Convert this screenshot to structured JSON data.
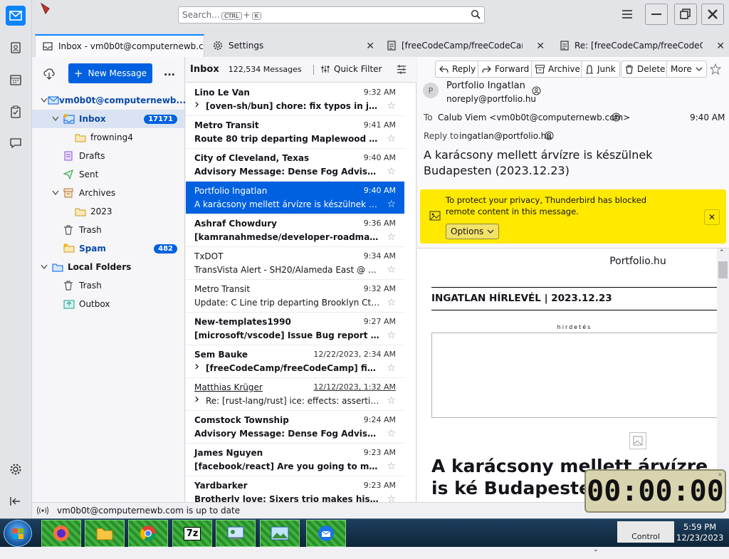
{
  "search": {
    "placeholder": "Search...",
    "key1": "CTRL",
    "plus": "+",
    "key2": "K"
  },
  "tabs": [
    {
      "label": "Inbox - vm0b0t@computernewb.com"
    },
    {
      "label": "Settings"
    },
    {
      "label": "[freeCodeCamp/freeCodeCamp] f"
    },
    {
      "label": "Re: [freeCodeCamp/freeCodeCam"
    }
  ],
  "folders": {
    "new_message": "New Message",
    "more": "...",
    "account": "vm0b0t@computernewb...",
    "inbox": "Inbox",
    "inbox_count": "17171",
    "frowning": "frowning4",
    "drafts": "Drafts",
    "sent": "Sent",
    "archives": "Archives",
    "archives_year": "2023",
    "trash": "Trash",
    "spam": "Spam",
    "spam_count": "482",
    "local_folders": "Local Folders",
    "local_trash": "Trash",
    "outbox": "Outbox"
  },
  "list": {
    "title": "Inbox",
    "count": "122,534 Messages",
    "quick_filter": "Quick Filter",
    "messages": [
      {
        "from": "Lino Le Van",
        "date": "9:32 AM",
        "subject": "[oven-sh/bun] chore: fix typos in js_p...",
        "thread": true
      },
      {
        "from": "Metro Transit",
        "date": "9:41 AM",
        "subject": "Route 80 trip departing Maplewood Mal..."
      },
      {
        "from": "City of Cleveland, Texas",
        "date": "9:40 AM",
        "subject": "Advisory Message: Dense Fog Advisory..."
      },
      {
        "from": "Portfolio Ingatlan",
        "date": "9:40 AM",
        "subject": "A karácsony mellett árvízre is készülnek Bu..."
      },
      {
        "from": "Ashraf Chowdury",
        "date": "9:36 AM",
        "subject": "[kamranahmedse/developer-roadmap] ..."
      },
      {
        "from": "TxDOT",
        "date": "9:34 AM",
        "subject": "TransVista Alert - SH20/Alameda East @ D..."
      },
      {
        "from": "Metro Transit",
        "date": "9:32 AM",
        "subject": "Update: C Line trip departing Brooklyn Ctr ..."
      },
      {
        "from": "New-templates1990",
        "date": "9:27 AM",
        "subject": "[microsoft/vscode] Issue Bug report (Iss..."
      },
      {
        "from": "Sem Bauke",
        "date": "12/22/2023, 2:34 AM",
        "subject": "[freeCodeCamp/freeCodeCamp] fix: ...",
        "thread": true
      },
      {
        "from": "Matthias Krüger",
        "date": "12/12/2023, 1:32 AM",
        "subject": "Re: [rust-lang/rust] ice: effects: assertion...",
        "thread": true
      },
      {
        "from": "Comstock Township",
        "date": "9:24 AM",
        "subject": "Advisory Message: Dense Fog Advisory..."
      },
      {
        "from": "James Nguyen",
        "date": "9:23 AM",
        "subject": "[facebook/react] Are you going to mak..."
      },
      {
        "from": "Yardbarker",
        "date": "9:23 AM",
        "subject": "Brotherly love: Sixers trio makes history..."
      }
    ]
  },
  "toolbar": {
    "reply": "Reply",
    "forward": "Forward",
    "archive": "Archive",
    "junk": "Junk",
    "delete": "Delete",
    "more": "More"
  },
  "header": {
    "from_name": "Portfolio Ingatlan",
    "from_email": "noreply@portfolio.hu",
    "avatar_letter": "P",
    "to_label": "To",
    "to": "Calub Viem <vm0b0t@computernewb.com>",
    "time": "9:40 AM",
    "replyto_label": "Reply to",
    "replyto": "ingatlan@portfolio.hu",
    "subject": "A karácsony mellett árvízre is készülnek Budapesten (2023.12.23)"
  },
  "privacy": {
    "text": "To protect your privacy, Thunderbird has blocked remote content in this message.",
    "options": "Options"
  },
  "body": {
    "site": "Portfolio.hu",
    "newsletter": "INGATLAN HÍRLEVÉL | 2023.12.23",
    "ad_label": "hirdetés",
    "headline": "A karácsony mellett árvízre is ké Budapesten"
  },
  "status": {
    "text": "vm0b0t@computernewb.com is up to date"
  },
  "taskbar": {
    "time": "5:59 PM",
    "date": "12/23/2023",
    "tray_text": "Control"
  },
  "timer": {
    "display": "00:00:00"
  },
  "colors": {
    "accent": "#0061e0",
    "privacy_bar": "#ffe900",
    "selected_row": "#0061e0"
  }
}
